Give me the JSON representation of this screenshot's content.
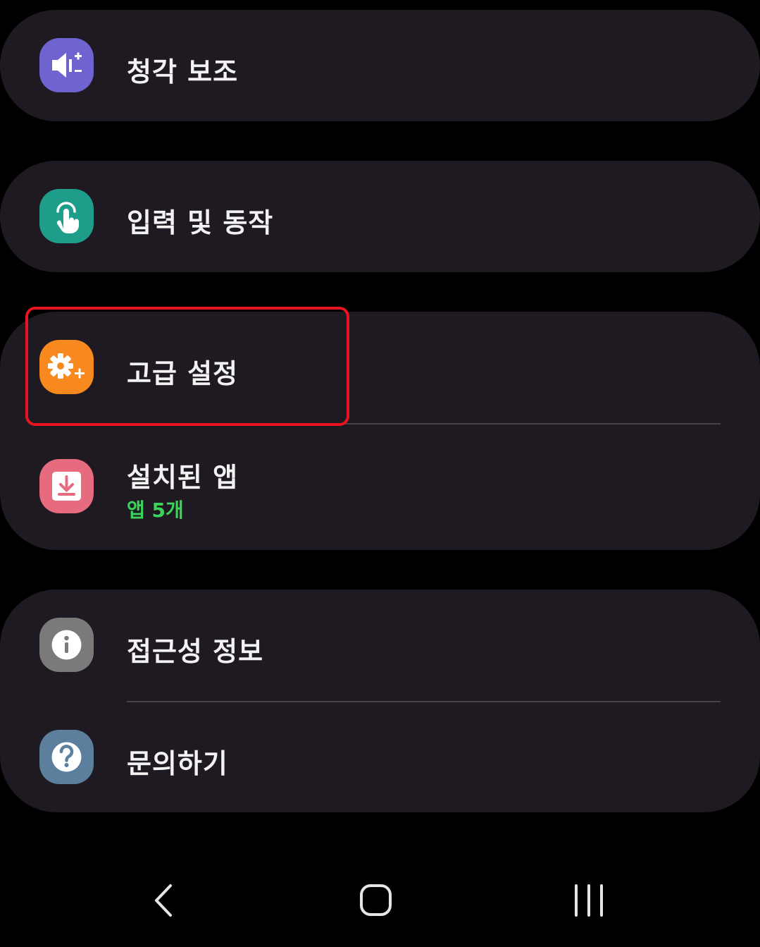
{
  "items": [
    {
      "label": "청각 보조",
      "icon": "hearing-speaker-plus-icon",
      "icon_color": "#6f63cf"
    },
    {
      "label": "입력 및 동작",
      "icon": "touch-hand-icon",
      "icon_color": "#1e9e8a"
    },
    {
      "label": "고급 설정",
      "icon": "gear-plus-icon",
      "icon_color": "#f7891e"
    },
    {
      "label": "설치된 앱",
      "sublabel": "앱 5개",
      "icon": "download-box-icon",
      "icon_color": "#e76b7f"
    },
    {
      "label": "접근성 정보",
      "icon": "info-icon",
      "icon_color": "#7a7a7a"
    },
    {
      "label": "문의하기",
      "icon": "help-question-icon",
      "icon_color": "#5c7f9e"
    }
  ],
  "colors": {
    "background": "#000000",
    "card": "#1f1a21",
    "sublabel_accent": "#3bd35c",
    "highlight_border": "#e8141f"
  },
  "navbar": {
    "back": "back-chevron-icon",
    "home": "home-rounded-square-icon",
    "recents": "recents-three-bars-icon"
  }
}
